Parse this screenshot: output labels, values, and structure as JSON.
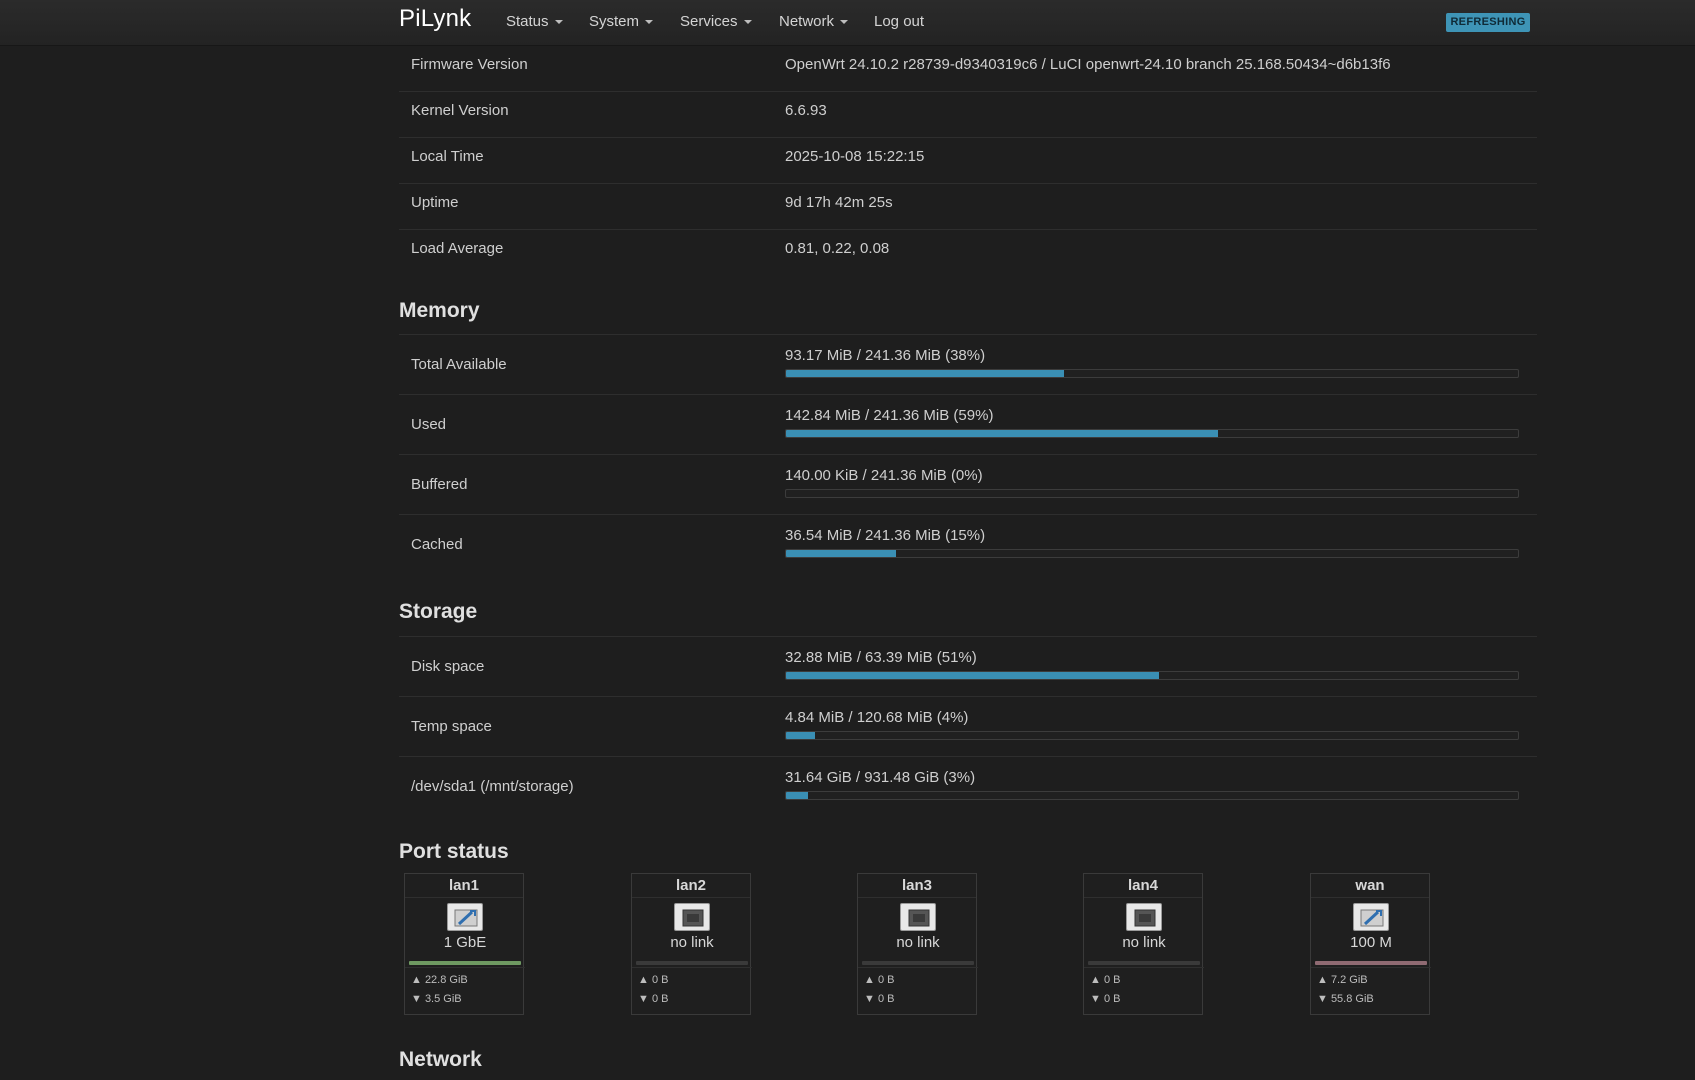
{
  "header": {
    "brand": "PiLynk",
    "nav": [
      {
        "label": "Status",
        "dropdown": true
      },
      {
        "label": "System",
        "dropdown": true
      },
      {
        "label": "Services",
        "dropdown": true
      },
      {
        "label": "Network",
        "dropdown": true
      },
      {
        "label": "Log out",
        "dropdown": false
      }
    ],
    "refresh_badge": "REFRESHING"
  },
  "system": [
    {
      "label": "Firmware Version",
      "value": "OpenWrt 24.10.2 r28739-d9340319c6 / LuCI openwrt-24.10 branch 25.168.50434~d6b13f6"
    },
    {
      "label": "Kernel Version",
      "value": "6.6.93"
    },
    {
      "label": "Local Time",
      "value": "2025-10-08 15:22:15"
    },
    {
      "label": "Uptime",
      "value": "9d 17h 42m 25s"
    },
    {
      "label": "Load Average",
      "value": "0.81, 0.22, 0.08"
    }
  ],
  "memory": {
    "title": "Memory",
    "rows": [
      {
        "label": "Total Available",
        "text": "93.17 MiB / 241.36 MiB (38%)",
        "percent": 38
      },
      {
        "label": "Used",
        "text": "142.84 MiB / 241.36 MiB (59%)",
        "percent": 59
      },
      {
        "label": "Buffered",
        "text": "140.00 KiB / 241.36 MiB (0%)",
        "percent": 0
      },
      {
        "label": "Cached",
        "text": "36.54 MiB / 241.36 MiB (15%)",
        "percent": 15
      }
    ]
  },
  "storage": {
    "title": "Storage",
    "rows": [
      {
        "label": "Disk space",
        "text": "32.88 MiB / 63.39 MiB (51%)",
        "percent": 51
      },
      {
        "label": "Temp space",
        "text": "4.84 MiB / 120.68 MiB (4%)",
        "percent": 4
      },
      {
        "label": "/dev/sda1 (/mnt/storage)",
        "text": "31.64 GiB / 931.48 GiB (3%)",
        "percent": 3
      }
    ]
  },
  "ports": {
    "title": "Port status",
    "items": [
      {
        "name": "lan1",
        "status": "1 GbE",
        "linked": true,
        "line_color": "#6f9a62",
        "tx": "▲ 22.8 GiB",
        "rx": "▼ 3.5 GiB"
      },
      {
        "name": "lan2",
        "status": "no link",
        "linked": false,
        "line_color": "#3a3a3a",
        "tx": "▲ 0 B",
        "rx": "▼ 0 B"
      },
      {
        "name": "lan3",
        "status": "no link",
        "linked": false,
        "line_color": "#3a3a3a",
        "tx": "▲ 0 B",
        "rx": "▼ 0 B"
      },
      {
        "name": "lan4",
        "status": "no link",
        "linked": false,
        "line_color": "#3a3a3a",
        "tx": "▲ 0 B",
        "rx": "▼ 0 B"
      },
      {
        "name": "wan",
        "status": "100 M",
        "linked": true,
        "line_color": "#8f6a72",
        "tx": "▲ 7.2 GiB",
        "rx": "▼ 55.8 GiB"
      }
    ]
  },
  "next_section": {
    "title": "Network"
  },
  "colors": {
    "accent": "#3a8fb4",
    "badge": "#3e94b6",
    "background": "#1e1e1e"
  }
}
